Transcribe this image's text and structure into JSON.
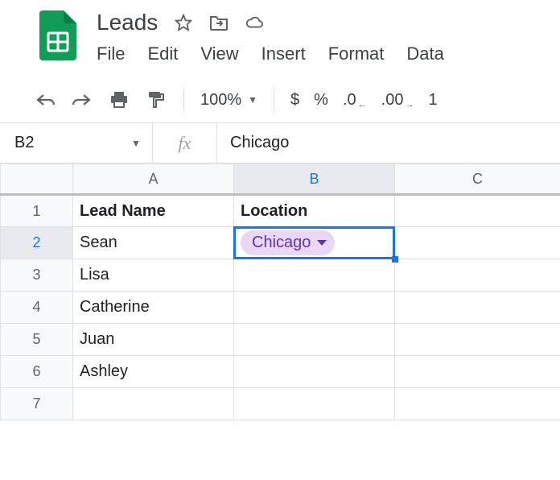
{
  "doc": {
    "title": "Leads"
  },
  "menu": {
    "file": "File",
    "edit": "Edit",
    "view": "View",
    "insert": "Insert",
    "format": "Format",
    "data": "Data"
  },
  "toolbar": {
    "zoom": "100%",
    "currency": "$",
    "percent": "%",
    "dec_dec": ".0",
    "inc_dec": ".00",
    "more": "1"
  },
  "active_cell": {
    "ref": "B2",
    "formula": "Chicago"
  },
  "columns": {
    "A": "A",
    "B": "B",
    "C": "C"
  },
  "rows": [
    "1",
    "2",
    "3",
    "4",
    "5",
    "6",
    "7"
  ],
  "sheet": {
    "headers": {
      "A": "Lead Name",
      "B": "Location"
    },
    "data": [
      {
        "name": "Sean",
        "location": "Chicago"
      },
      {
        "name": "Lisa",
        "location": ""
      },
      {
        "name": "Catherine",
        "location": ""
      },
      {
        "name": "Juan",
        "location": ""
      },
      {
        "name": "Ashley",
        "location": ""
      }
    ]
  },
  "fx_label": "fx"
}
